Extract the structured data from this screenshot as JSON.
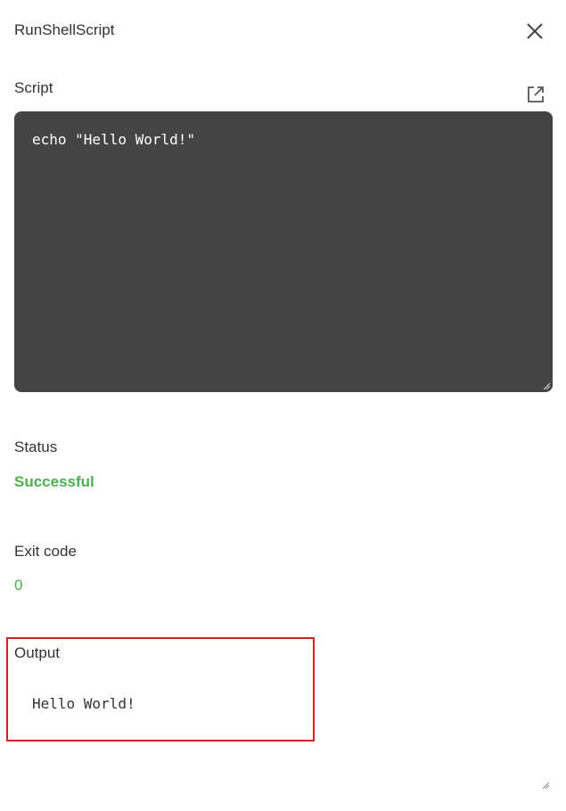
{
  "dialog": {
    "title": "RunShellScript"
  },
  "script": {
    "label": "Script",
    "code": "echo \"Hello World!\""
  },
  "status": {
    "label": "Status",
    "value": "Successful",
    "color": "#4caf50"
  },
  "exit_code": {
    "label": "Exit code",
    "value": "0"
  },
  "output": {
    "label": "Output",
    "value": "Hello World!",
    "highlight_color": "#d32027"
  },
  "icons": {
    "close": "close-icon",
    "open_external": "open-external-icon",
    "resize": "resize-grip-icon"
  },
  "colors": {
    "editor_background": "#444444",
    "success": "#4caf50"
  }
}
